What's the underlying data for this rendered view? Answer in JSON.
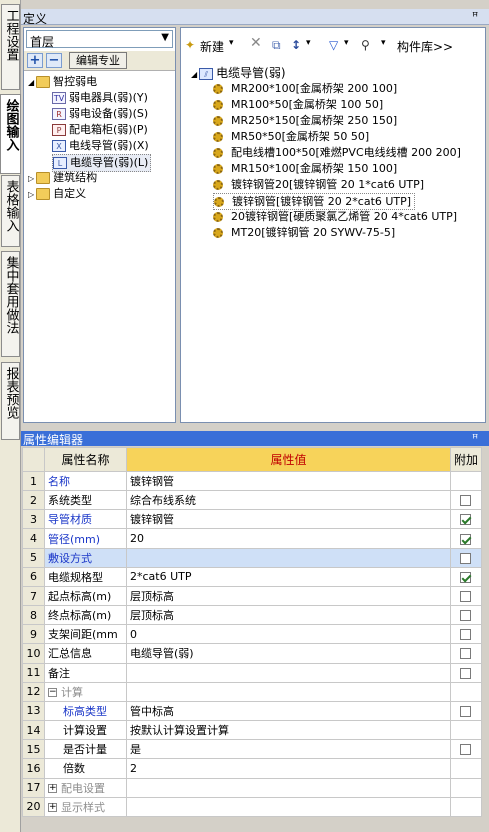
{
  "left_tabs": [
    "工程设置",
    "绘图输入",
    "表格输入",
    "集中套用做法",
    "报表预览"
  ],
  "top_panel": {
    "title": "定义",
    "pin": "ꟸ",
    "close": "×"
  },
  "floor_select": {
    "value": "首层"
  },
  "tree_toolbar": {
    "edit_label": "编辑专业"
  },
  "tree": {
    "root": "智控弱电",
    "children": [
      {
        "icon": "TV",
        "label": "弱电器具(弱)(Y)"
      },
      {
        "icon": "R",
        "label": "弱电设备(弱)(S)"
      },
      {
        "icon": "P",
        "label": "配电箱柜(弱)(P)"
      },
      {
        "icon": "X",
        "label": "电线导管(弱)(X)"
      },
      {
        "icon": "L",
        "label": "电缆导管(弱)(L)"
      }
    ],
    "others": [
      "建筑结构",
      "自定义"
    ]
  },
  "right_toolbar": {
    "new_label": "新建",
    "lib_label": "构件库>>"
  },
  "component_group": "电缆导管(弱)",
  "components": [
    "MR200*100[金属桥架 200 100]",
    "MR100*50[金属桥架 100 50]",
    "MR250*150[金属桥架 250 150]",
    "MR50*50[金属桥架 50 50]",
    "配电线槽100*50[难燃PVC电线线槽 200 200]",
    "MR150*100[金属桥架 150 100]",
    "镀锌钢管20[镀锌钢管 20 1*cat6 UTP]",
    "镀锌钢管[镀锌钢管 20 2*cat6 UTP]",
    "20镀锌钢管[硬质聚氯乙烯管 20 4*cat6 UTP]",
    "MT20[镀锌钢管 20 SYWV-75-5]"
  ],
  "prop_panel": {
    "title": "属性编辑器",
    "pin": "ꟸ",
    "close": "×"
  },
  "prop_headers": {
    "name": "属性名称",
    "value": "属性值",
    "extra": "附加"
  },
  "props": [
    {
      "n": "1",
      "name": "名称",
      "value": "镀锌钢管",
      "check": null,
      "style": "blue"
    },
    {
      "n": "2",
      "name": "系统类型",
      "value": "综合布线系统",
      "check": false,
      "style": ""
    },
    {
      "n": "3",
      "name": "导管材质",
      "value": "镀锌钢管",
      "check": true,
      "style": "blue"
    },
    {
      "n": "4",
      "name": "管径(mm)",
      "value": "20",
      "check": true,
      "style": "blue"
    },
    {
      "n": "5",
      "name": "敷设方式",
      "value": "",
      "check": false,
      "style": "blue hl"
    },
    {
      "n": "6",
      "name": "电缆规格型",
      "value": "2*cat6 UTP",
      "check": true,
      "style": ""
    },
    {
      "n": "7",
      "name": "起点标高(m)",
      "value": "层顶标高",
      "check": false,
      "style": ""
    },
    {
      "n": "8",
      "name": "终点标高(m)",
      "value": "层顶标高",
      "check": false,
      "style": ""
    },
    {
      "n": "9",
      "name": "支架间距(mm",
      "value": "0",
      "check": false,
      "style": ""
    },
    {
      "n": "10",
      "name": "汇总信息",
      "value": "电缆导管(弱)",
      "check": false,
      "style": ""
    },
    {
      "n": "11",
      "name": "备注",
      "value": "",
      "check": false,
      "style": ""
    },
    {
      "n": "12",
      "name": "计算",
      "value": "",
      "check": null,
      "style": "group"
    },
    {
      "n": "13",
      "name": "标高类型",
      "value": "管中标高",
      "check": false,
      "style": "blue sub"
    },
    {
      "n": "14",
      "name": "计算设置",
      "value": "按默认计算设置计算",
      "check": null,
      "style": "sub"
    },
    {
      "n": "15",
      "name": "是否计量",
      "value": "是",
      "check": false,
      "style": "sub"
    },
    {
      "n": "16",
      "name": "倍数",
      "value": "2",
      "check": null,
      "style": "sub"
    },
    {
      "n": "17",
      "name": "配电设置",
      "value": "",
      "check": null,
      "style": "group"
    },
    {
      "n": "20",
      "name": "显示样式",
      "value": "",
      "check": null,
      "style": "group"
    }
  ]
}
